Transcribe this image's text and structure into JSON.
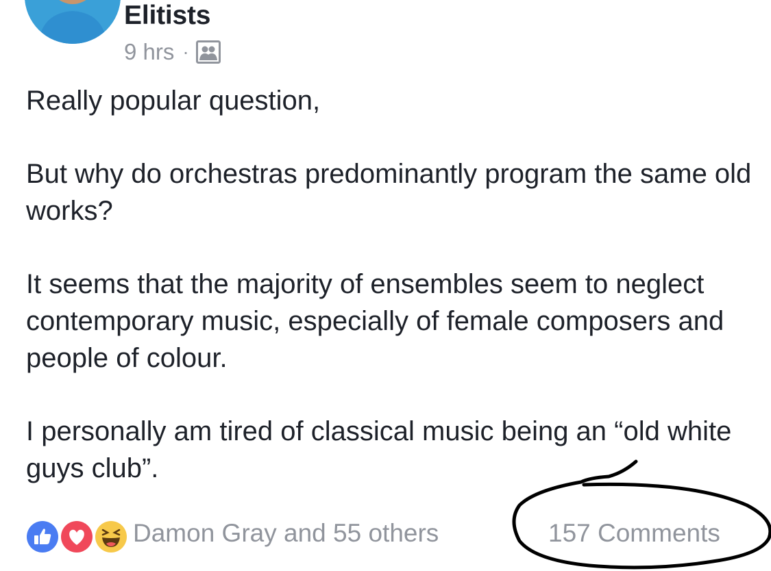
{
  "post": {
    "group_name": "Elitists",
    "timestamp": "9 hrs",
    "separator": "·",
    "audience_icon": "group-audience-icon",
    "paragraphs": [
      "Really popular question,",
      "But why do orchestras predominantly program the same old works?",
      "It seems that the majority of ensembles seem to neglect contemporary music, especially of female composers and people of colour.",
      "I personally am tired of classical music being an “old white guys club”."
    ]
  },
  "footer": {
    "reaction_icons": [
      "like-icon",
      "love-icon",
      "haha-icon"
    ],
    "reactors_text": "Damon Gray and 55 others",
    "comments_text": "157 Comments"
  },
  "colors": {
    "text_primary": "#1d2129",
    "text_secondary": "#90949c",
    "like_blue": "#4a7cf2",
    "love_red": "#f0485a",
    "haha_yellow": "#f7c94a",
    "annotation_ink": "#000000"
  }
}
